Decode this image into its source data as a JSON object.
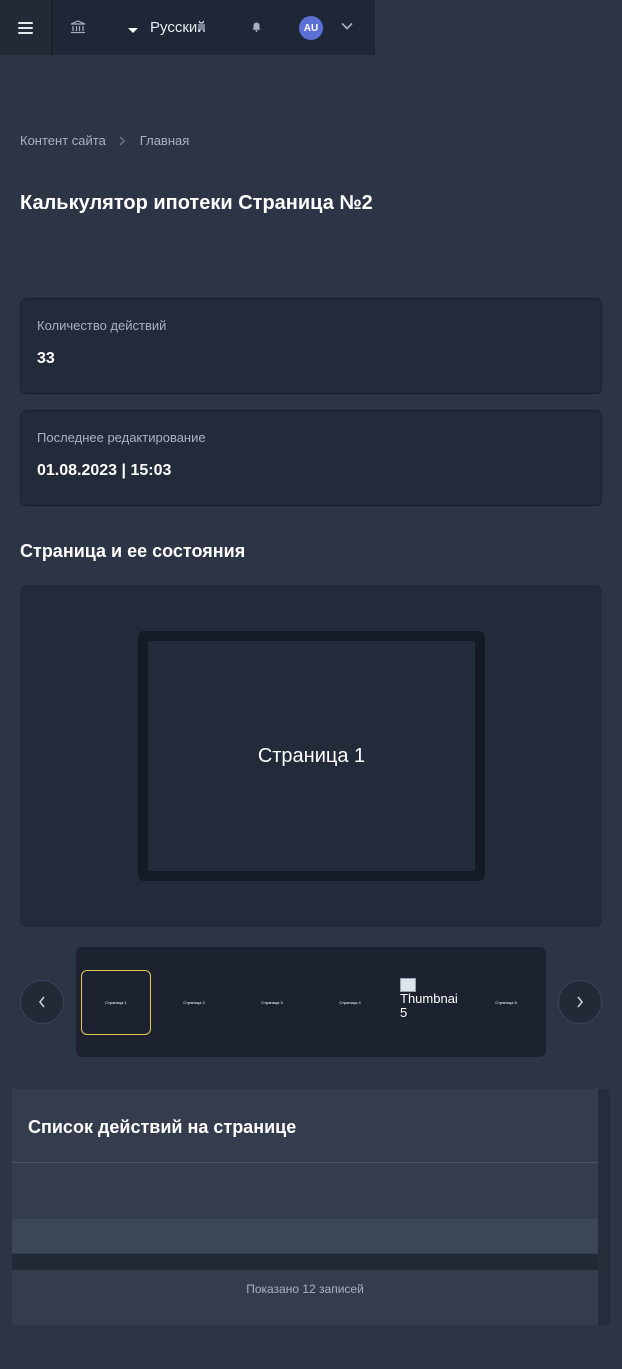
{
  "header": {
    "language": "Русский",
    "avatar_initials": "AU"
  },
  "breadcrumb": {
    "items": [
      "Контент сайта",
      "Главная"
    ]
  },
  "page": {
    "title": "Калькулятор ипотеки Страница №2"
  },
  "stats": [
    {
      "label": "Количество действий",
      "value": "33"
    },
    {
      "label": "Последнее редактирование",
      "value": "01.08.2023 | 15:03"
    }
  ],
  "states": {
    "title": "Страница и ее состояния",
    "current_label": "Страница 1",
    "thumbnails": [
      {
        "label": "Страница 1",
        "active": true
      },
      {
        "label": "Страница 2",
        "active": false
      },
      {
        "label": "Страница 3",
        "active": false
      },
      {
        "label": "Страница 4",
        "active": false
      },
      {
        "label": "Thumbnail 5",
        "active": false,
        "broken": true
      },
      {
        "label": "Страница 6",
        "active": false
      }
    ]
  },
  "actions": {
    "title": "Список действий на странице",
    "footer": "Показано 12 записей"
  },
  "colors": {
    "background": "#2d3446",
    "card": "#232b3a",
    "accent": "#e2c94a",
    "avatar": "#5b6fd6"
  }
}
